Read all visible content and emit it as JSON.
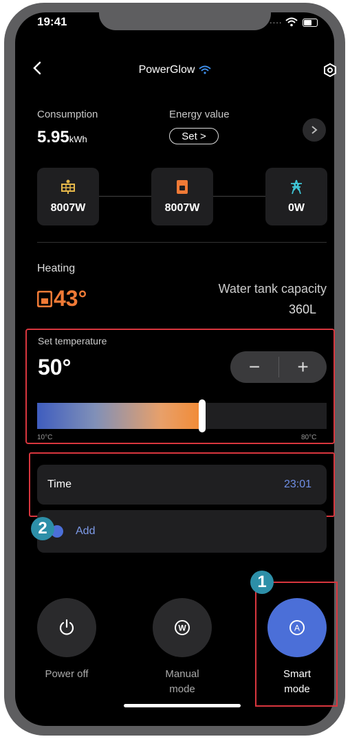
{
  "status_bar": {
    "time": "19:41",
    "signal_dots": "...."
  },
  "header": {
    "title": "PowerGlow"
  },
  "energy": {
    "consumption_label": "Consumption",
    "consumption_value": "5.95",
    "consumption_unit": "kWh",
    "energy_value_label": "Energy value",
    "set_button": "Set >"
  },
  "flow": {
    "solar": "8007W",
    "heater": "8007W",
    "grid": "0W"
  },
  "heating": {
    "label": "Heating",
    "current_temp": "43°",
    "tank_label": "Water tank capacity",
    "tank_value": "360L"
  },
  "set_temperature": {
    "label": "Set temperature",
    "value": "50°",
    "minus": "−",
    "plus": "+",
    "min_label": "10°C",
    "max_label": "80°C",
    "min": 10,
    "max": 80,
    "target": 50,
    "fill_fraction": 0.57
  },
  "schedule": {
    "time_label": "Time",
    "time_value": "23:01",
    "add_label": "Add"
  },
  "annotations": {
    "badge_1": "1",
    "badge_2": "2"
  },
  "modes": {
    "power_off": "Power off",
    "manual_line1": "Manual",
    "manual_line2": "mode",
    "smart_line1": "Smart",
    "smart_line2": "mode"
  },
  "colors": {
    "accent": "#4b6fd8",
    "heating_orange": "#f07a36",
    "highlight_red": "#d9363e",
    "badge_teal": "#2d8fa8"
  }
}
